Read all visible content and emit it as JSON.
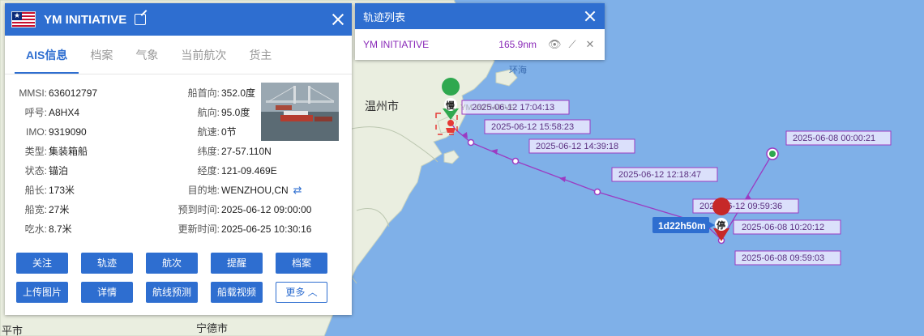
{
  "ship_panel": {
    "name": "YM INITIATIVE",
    "tabs": [
      "AIS信息",
      "档案",
      "气象",
      "当前航次",
      "货主"
    ],
    "left_fields": [
      {
        "label": "MMSI:",
        "value": "636012797"
      },
      {
        "label": "呼号:",
        "value": "A8HX4"
      },
      {
        "label": "IMO:",
        "value": "9319090"
      },
      {
        "label": "类型:",
        "value": "集装箱船"
      },
      {
        "label": "状态:",
        "value": "锚泊"
      },
      {
        "label": "船长:",
        "value": "173米"
      },
      {
        "label": "船宽:",
        "value": "27米"
      },
      {
        "label": "吃水:",
        "value": "8.7米"
      }
    ],
    "right_fields": [
      {
        "label": "船首向:",
        "value": "352.0度"
      },
      {
        "label": "航向:",
        "value": "95.0度"
      },
      {
        "label": "航速:",
        "value": "0节"
      },
      {
        "label": "纬度:",
        "value": "27-57.110N"
      },
      {
        "label": "经度:",
        "value": "121-09.469E"
      },
      {
        "label": "目的地:",
        "value": "WENZHOU,CN"
      },
      {
        "label": "预到时间:",
        "value": "2025-06-12 09:00:00"
      },
      {
        "label": "更新时间:",
        "value": "2025-06-25 10:30:16"
      }
    ],
    "buttons": [
      "关注",
      "轨迹",
      "航次",
      "提醒",
      "档案",
      "上传图片",
      "详情",
      "航线预测",
      "船载视频",
      "更多"
    ]
  },
  "track_list": {
    "title": "轨迹列表",
    "ship": "YM INITIATIVE",
    "distance": "165.9nm"
  },
  "map": {
    "cities": [
      "温州市",
      "宁德市",
      "平市"
    ],
    "place": "环海",
    "duration_badge": "1d22h50m",
    "markers": {
      "slow": "慢",
      "stop": "停"
    },
    "track_labels": [
      "2025-06-12 17:04:13",
      "2025-06-12 15:58:23",
      "2025-06-12 14:39:18",
      "2025-06-12 12:18:47",
      "2025-06-08 00:00:21",
      "2025-06-12 09:59:36",
      "2025-06-08 10:20:12",
      "2025-06-08 09:59:03"
    ],
    "ghost_label": "YM INITIATIVE",
    "colors": {
      "sea": "#7fb0e8",
      "land": "#eaeee0",
      "track": "#9b3bc2",
      "accent": "#2e6ed0"
    }
  }
}
